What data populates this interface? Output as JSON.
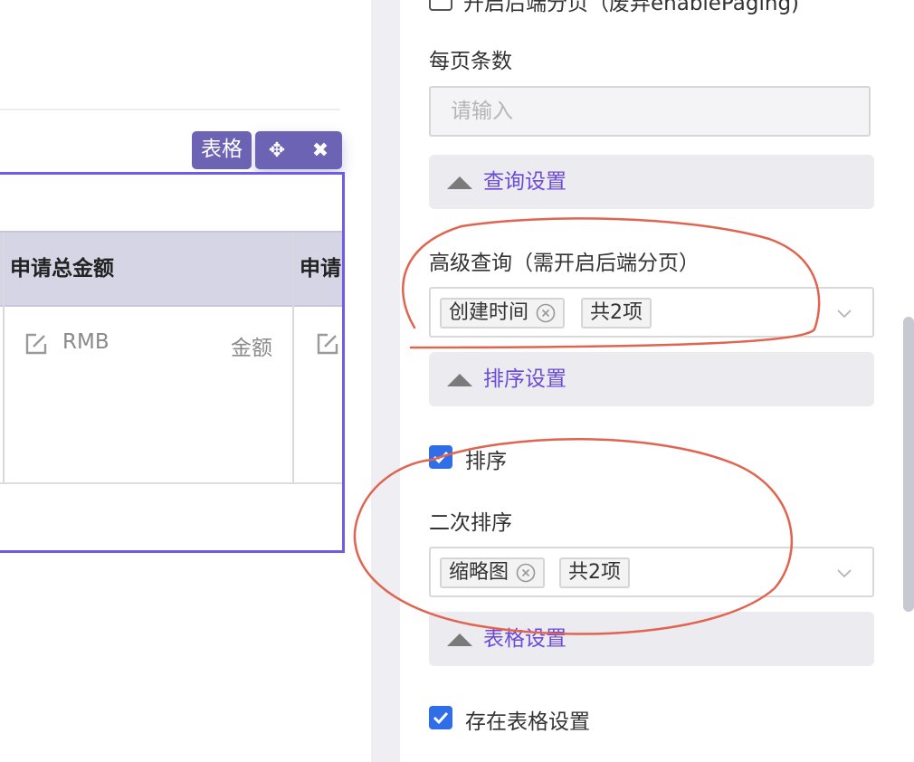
{
  "canvas": {
    "component_tag": "表格",
    "table": {
      "headers": [
        "申请总金额",
        "申请"
      ],
      "row": {
        "cell1_prefix": "RMB",
        "cell1_placeholder": "金额"
      }
    }
  },
  "panel": {
    "top_checkbox_label": "开启后端分页（废弃enablePaging)",
    "page_size": {
      "label": "每页条数",
      "placeholder": "请输入"
    },
    "query_section": "查询设置",
    "advanced_query": {
      "label": "高级查询（需开启后端分页）",
      "chips": [
        "创建时间",
        "共2项"
      ]
    },
    "sort_section": "排序设置",
    "sort_checkbox": {
      "label": "排序",
      "checked": true
    },
    "secondary_sort": {
      "label": "二次排序",
      "chips": [
        "缩略图",
        "共2项"
      ]
    },
    "table_section": "表格设置",
    "table_settings_checkbox": {
      "label": "存在表格设置",
      "checked": true
    }
  },
  "colors": {
    "accent": "#6c5ce7",
    "toolbar": "#6c63b5",
    "link": "#6c4bd8",
    "checkbox": "#2f6ee6",
    "annotation": "#e0644f"
  }
}
